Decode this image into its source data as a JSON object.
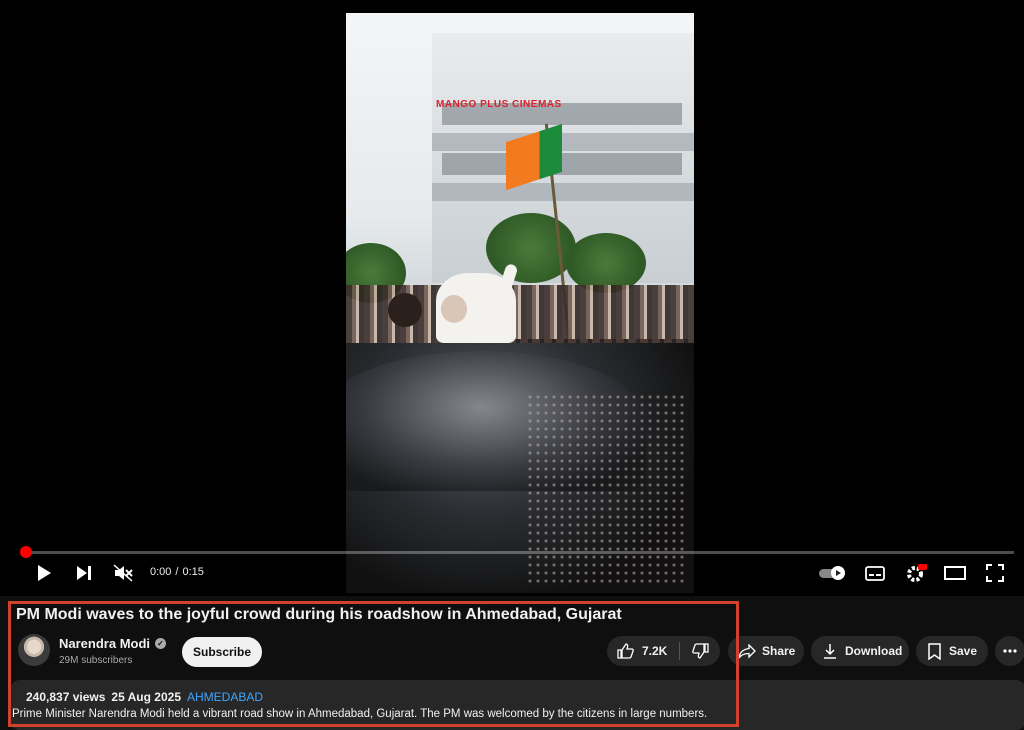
{
  "video": {
    "current_time": "0:00",
    "time_separator": "/",
    "duration": "0:15",
    "progress_fraction": 0.0,
    "overlay_sign_text": "MANGO PLUS CINEMAS"
  },
  "info": {
    "title": "PM Modi waves to the joyful crowd during his roadshow in Ahmedabad, Gujarat",
    "channel_name": "Narendra Modi",
    "subscribers": "29M subscribers",
    "subscribe_label": "Subscribe",
    "likes": "7.2K",
    "share_label": "Share",
    "download_label": "Download",
    "save_label": "Save",
    "views": "240,837 views",
    "date": "25 Aug 2025",
    "hashtag": "AHMEDABAD",
    "description": "Prime Minister Narendra Modi held a vibrant road show in Ahmedabad, Gujarat. The PM was welcomed by the citizens in large numbers."
  },
  "icons": {
    "play": "play-icon",
    "next": "next-icon",
    "mute": "mute-icon",
    "autoplay": "autoplay-toggle-icon",
    "subtitles": "subtitles-icon",
    "settings": "settings-icon",
    "theater": "theater-mode-icon",
    "fullscreen": "fullscreen-icon",
    "like": "thumbs-up-icon",
    "dislike": "thumbs-down-icon",
    "share": "share-icon",
    "download": "download-icon",
    "save": "bookmark-icon",
    "more": "more-icon",
    "verified": "verified-icon"
  },
  "colors": {
    "progress": "#ff0000",
    "highlight": "#d2412c",
    "hashtag": "#3ea6ff"
  }
}
